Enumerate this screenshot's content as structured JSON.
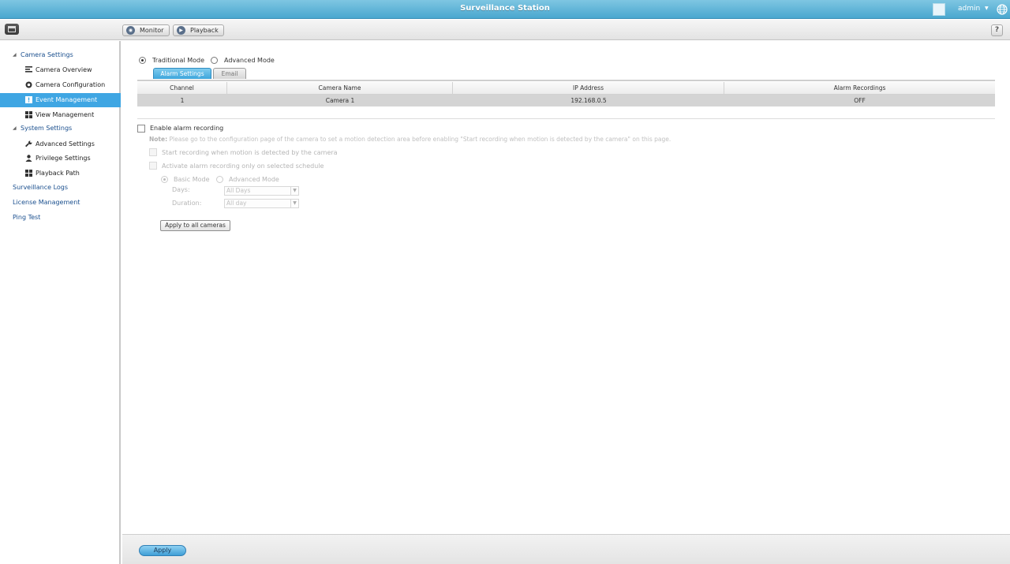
{
  "window": {
    "title": "Surveillance Station",
    "user": "admin"
  },
  "toolbar": {
    "monitor_label": "Monitor",
    "playback_label": "Playback",
    "help_label": "?"
  },
  "sidebar": {
    "camera_settings": "Camera Settings",
    "camera_overview": "Camera Overview",
    "camera_configuration": "Camera Configuration",
    "event_management": "Event Management",
    "view_management": "View Management",
    "system_settings": "System Settings",
    "advanced_settings": "Advanced Settings",
    "privilege_settings": "Privilege Settings",
    "playback_path": "Playback Path",
    "surveillance_logs": "Surveillance Logs",
    "license_management": "License Management",
    "ping_test": "Ping Test"
  },
  "mode": {
    "traditional": "Traditional Mode",
    "advanced": "Advanced Mode",
    "selected": "traditional"
  },
  "tabs": {
    "alarm_settings": "Alarm Settings",
    "email": "Email",
    "active": "alarm_settings"
  },
  "table": {
    "columns": [
      "Channel",
      "Camera Name",
      "IP Address",
      "Alarm Recordings"
    ],
    "rows": [
      {
        "channel": "1",
        "camera_name": "Camera 1",
        "ip_address": "192.168.0.5",
        "alarm_recordings": "OFF"
      }
    ]
  },
  "alarm": {
    "enable_label": "Enable alarm recording",
    "note_prefix": "Note:",
    "note_text": "Please go to the configuration page of the camera to set a motion detection area before enabling \"Start recording when motion is detected by the camera\" on this page.",
    "start_recording_label": "Start recording when motion is detected by the camera",
    "activate_schedule_label": "Activate alarm recording only on selected schedule",
    "basic_mode": "Basic Mode",
    "advanced_mode": "Advanced Mode",
    "days_label": "Days:",
    "days_value": "All Days",
    "duration_label": "Duration:",
    "duration_value": "All day",
    "apply_all_label": "Apply to all cameras"
  },
  "footer": {
    "apply_label": "Apply"
  },
  "colors": {
    "titlebar": "#4aa7cf",
    "nav_active": "#3fa6e3",
    "nav_link": "#1a4f8e"
  }
}
